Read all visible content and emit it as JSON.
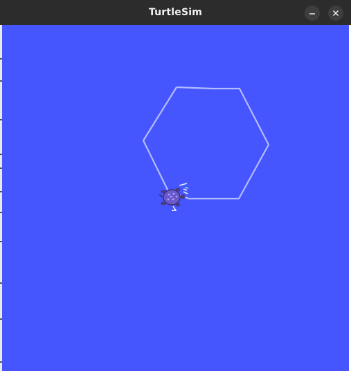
{
  "window": {
    "title": "TurtleSim",
    "buttons": {
      "minimize_icon": "minimize-icon",
      "close_icon": "close-icon"
    }
  },
  "canvas": {
    "background_color": "#4556ff",
    "pen_color": "#b3bbff",
    "turtle": {
      "icon": "turtle-icon",
      "shell_color": "#6a5acd"
    }
  }
}
